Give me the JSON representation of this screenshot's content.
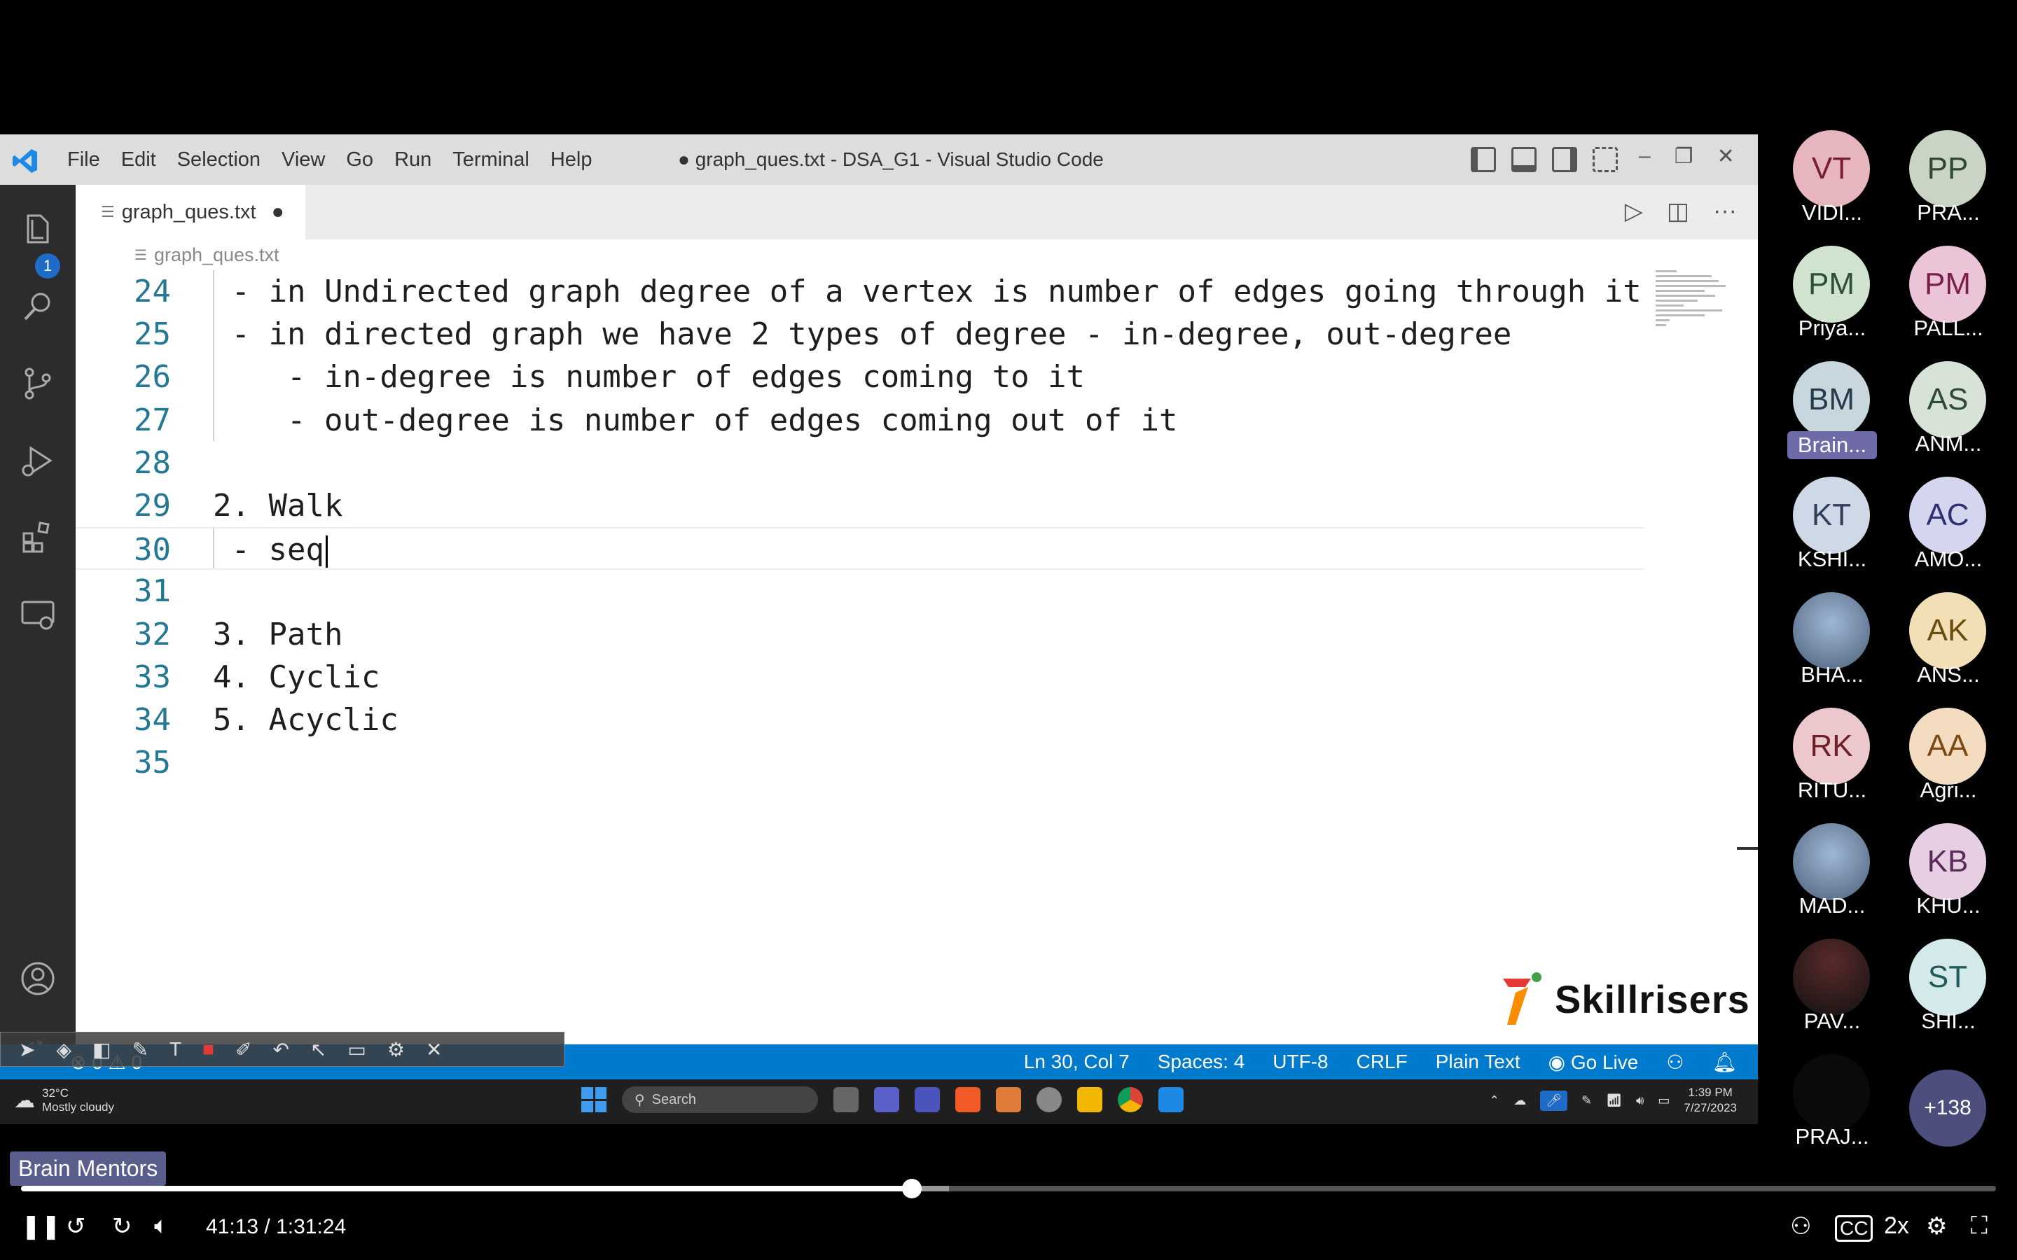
{
  "vscode": {
    "menu": [
      "File",
      "Edit",
      "Selection",
      "View",
      "Go",
      "Run",
      "Terminal",
      "Help"
    ],
    "window_title": "● graph_ques.txt - DSA_G1 - Visual Studio Code",
    "explorer_badge": "1",
    "tab_name": "graph_ques.txt",
    "tab_modified": "●",
    "breadcrumb": "graph_ques.txt",
    "lines": [
      {
        "num": "24",
        "text": " - in Undirected graph degree of a vertex is number of edges going through it"
      },
      {
        "num": "25",
        "text": " - in directed graph we have 2 types of degree - in-degree, out-degree"
      },
      {
        "num": "26",
        "text": "    - in-degree is number of edges coming to it"
      },
      {
        "num": "27",
        "text": "    - out-degree is number of edges coming out of it"
      },
      {
        "num": "28",
        "text": ""
      },
      {
        "num": "29",
        "text": "2. Walk"
      },
      {
        "num": "30",
        "text": " - seq"
      },
      {
        "num": "31",
        "text": ""
      },
      {
        "num": "32",
        "text": "3. Path"
      },
      {
        "num": "33",
        "text": "4. Cyclic"
      },
      {
        "num": "34",
        "text": "5. Acyclic"
      },
      {
        "num": "35",
        "text": ""
      }
    ],
    "current_line_index": 6,
    "watermark": "Skillrisers",
    "status": {
      "left_counts": "⊗ 0 ⚠ 0",
      "position": "Ln 30, Col 7",
      "spaces": "Spaces: 4",
      "encoding": "UTF-8",
      "eol": "CRLF",
      "language": "Plain Text",
      "go_live": "Go Live"
    },
    "accent_color": "#007acc"
  },
  "taskbar": {
    "weather_temp": "32°C",
    "weather_desc": "Mostly cloudy",
    "search_label": "Search",
    "time": "1:39 PM",
    "date": "7/27/2023"
  },
  "participants": [
    {
      "initials": "VT",
      "name": "VIDI...",
      "bg": "#e6b5be",
      "fg": "#7a1e33"
    },
    {
      "initials": "PP",
      "name": "PRA...",
      "bg": "#c9d4c4",
      "fg": "#2f4a2f"
    },
    {
      "initials": "PM",
      "name": "Priya...",
      "bg": "#cfe3cf",
      "fg": "#2d4f36"
    },
    {
      "initials": "PM",
      "name": "PALL...",
      "bg": "#ecc4d8",
      "fg": "#7a1f4d"
    },
    {
      "initials": "BM",
      "name": "Brain...",
      "bg": "#c8d6de",
      "fg": "#253c4d",
      "highlight": true
    },
    {
      "initials": "AS",
      "name": "ANM...",
      "bg": "#d6e3d6",
      "fg": "#2e4a3a"
    },
    {
      "initials": "KT",
      "name": "KSHI...",
      "bg": "#cfd8e6",
      "fg": "#2f3f5c"
    },
    {
      "initials": "AC",
      "name": "AMO...",
      "bg": "#d3d6ee",
      "fg": "#2d3372"
    },
    {
      "initials": "",
      "name": "BHA...",
      "photo": true
    },
    {
      "initials": "AK",
      "name": "ANS...",
      "bg": "#f2dfb5",
      "fg": "#6a4b10"
    },
    {
      "initials": "RK",
      "name": "RITU...",
      "bg": "#ecc8cc",
      "fg": "#6d1f28"
    },
    {
      "initials": "AA",
      "name": "Agri...",
      "bg": "#f4dcc0",
      "fg": "#7a4a12"
    },
    {
      "initials": "",
      "name": "MAD...",
      "photo": true
    },
    {
      "initials": "KB",
      "name": "KHU...",
      "bg": "#e6cfe3",
      "fg": "#5a2a5a"
    },
    {
      "initials": "",
      "name": "PAV...",
      "dark": true
    },
    {
      "initials": "ST",
      "name": "SHI...",
      "bg": "#d3e9ea",
      "fg": "#245a5c"
    },
    {
      "initials": "",
      "name": "PRAJ...",
      "blank": true
    },
    {
      "initials": "+138",
      "name": "",
      "bg": "#4c4f7e",
      "fg": "#ffffff",
      "more": true
    }
  ],
  "player": {
    "channel": "Brain Mentors",
    "current_time": "41:13",
    "duration": "1:31:24",
    "time_display": "41:13 / 1:31:24",
    "progress_fraction": 0.451,
    "buffer_fraction": 0.47,
    "speed": "2x"
  }
}
